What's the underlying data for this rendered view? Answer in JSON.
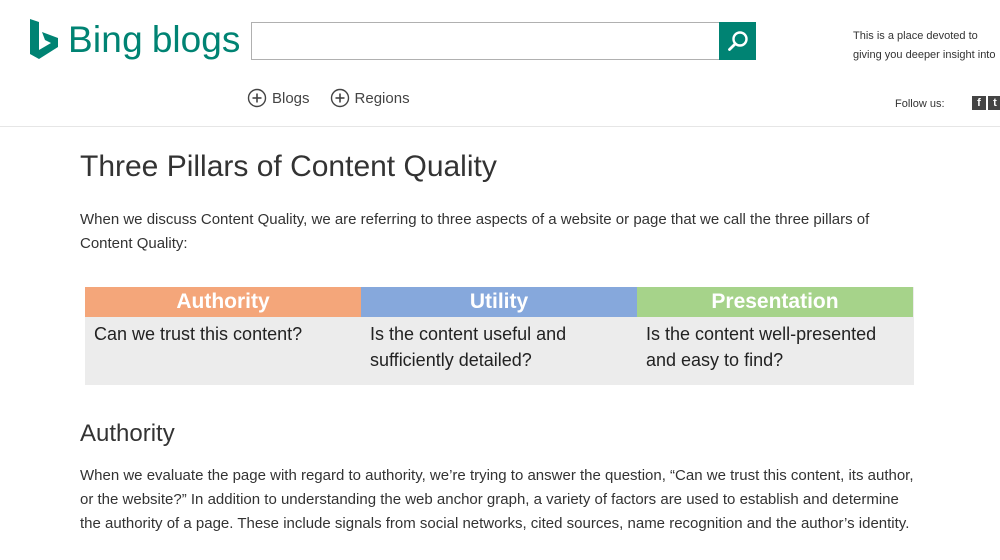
{
  "brand": {
    "name_bing": "Bing",
    "name_blogs": "blogs",
    "accent_color": "#008373"
  },
  "search": {
    "placeholder": "",
    "value": "",
    "button_icon": "search-icon"
  },
  "tagline": "This is a place devoted to giving you deeper insight into the news, trends, people and technology behind Bing.",
  "nav": {
    "items": [
      {
        "label": "Blogs",
        "icon": "plus-circle-icon"
      },
      {
        "label": "Regions",
        "icon": "plus-circle-icon"
      }
    ]
  },
  "follow": {
    "label": "Follow us:",
    "facebook_glyph": "f",
    "twitter_glyph": "t"
  },
  "article": {
    "title": "Three Pillars of Content Quality",
    "intro": "When we discuss Content Quality, we are referring to three aspects of a website or page that we call the three pillars of Content Quality:",
    "pillars": [
      {
        "title": "Authority",
        "question": "Can we trust this content?",
        "color": "#f4a67a"
      },
      {
        "title": "Utility",
        "question": "Is the content useful and sufficiently detailed?",
        "color": "#86a8dc"
      },
      {
        "title": "Presentation",
        "question": "Is the content well-presented and easy to find?",
        "color": "#a6d38a"
      }
    ],
    "section_title": "Authority",
    "section_body": "When we evaluate the page with regard to authority, we’re trying to answer the question, “Can we trust this content, its author, or the website?” In addition to understanding the web anchor graph, a variety of factors are used to establish and determine the authority of a page. These include signals from social networks, cited sources, name recognition and the author’s identity."
  }
}
